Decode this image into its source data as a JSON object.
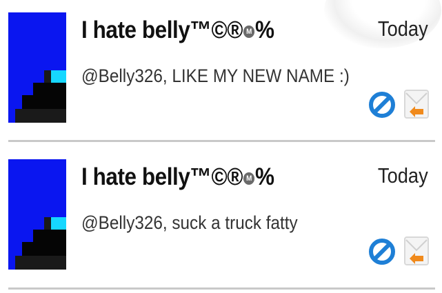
{
  "feed": {
    "items": [
      {
        "author_prefix": "I hate belly™©®",
        "author_suffix": "%",
        "badge_letter": "M",
        "time": "Today",
        "message": "@Belly326, LIKE MY NEW NAME :)"
      },
      {
        "author_prefix": "I hate belly™©®",
        "author_suffix": "%",
        "badge_letter": "M",
        "time": "Today",
        "message": "@Belly326, suck a truck fatty"
      }
    ]
  },
  "colors": {
    "avatar_bg": "#0a16f0",
    "avatar_accent": "#16d7ff",
    "block_icon": "#1e7fd6",
    "reply_icon": "#f08a1c",
    "divider": "#c8c8c8"
  },
  "icons": {
    "block": "block-icon",
    "reply": "reply-envelope-icon"
  }
}
